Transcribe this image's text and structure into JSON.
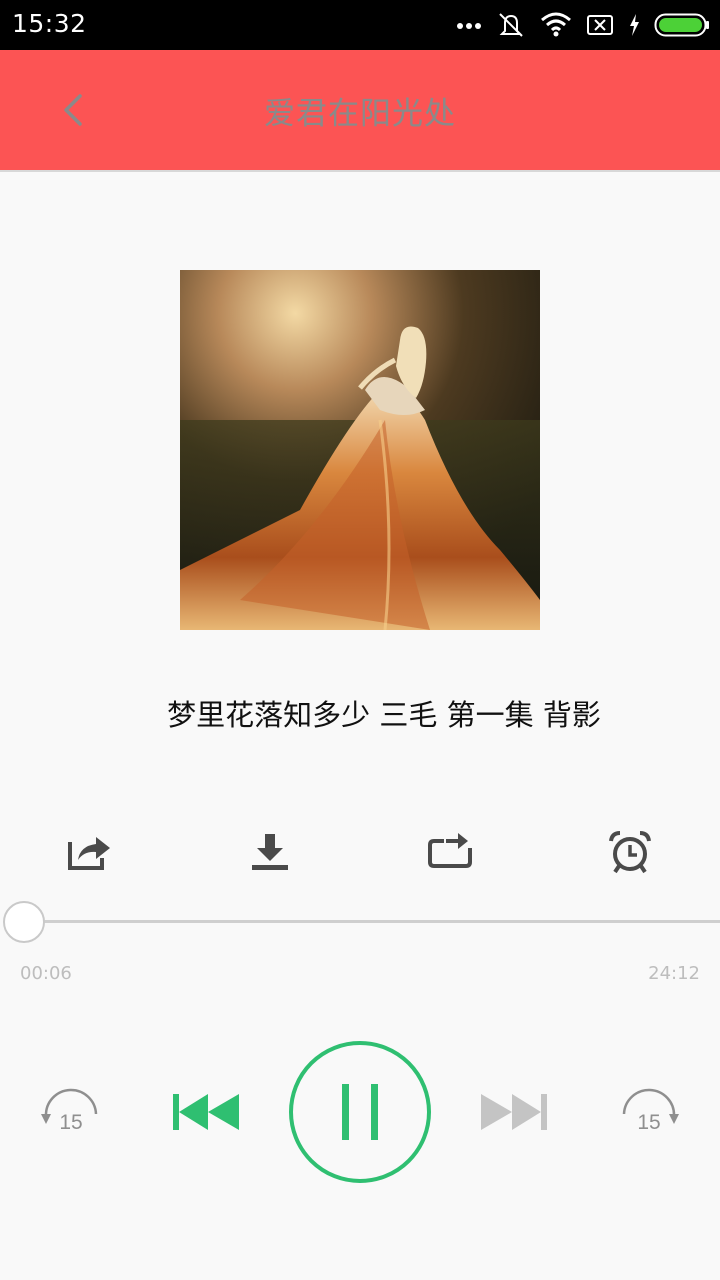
{
  "status_bar": {
    "time": "15:32",
    "icons": [
      "more-dots-icon",
      "mute-icon",
      "wifi-icon",
      "no-sim-icon",
      "charging-icon",
      "battery-icon"
    ]
  },
  "toolbar": {
    "title": "爱君在阳光处",
    "back_icon": "back-arrow-icon",
    "background": "#fc5454"
  },
  "cover": {
    "image": "album-cover-art"
  },
  "track": {
    "title": "梦里花落知多少 三毛 第一集 背影"
  },
  "actions": [
    "share-icon",
    "download-icon",
    "repeat-icon",
    "alarm-clock-icon"
  ],
  "progress": {
    "current": "00:06",
    "total": "24:12",
    "fraction": 0.004
  },
  "controls": {
    "rewind_seconds": "15",
    "forward_seconds": "15",
    "accent": "#2fbf71",
    "play_state": "playing"
  }
}
